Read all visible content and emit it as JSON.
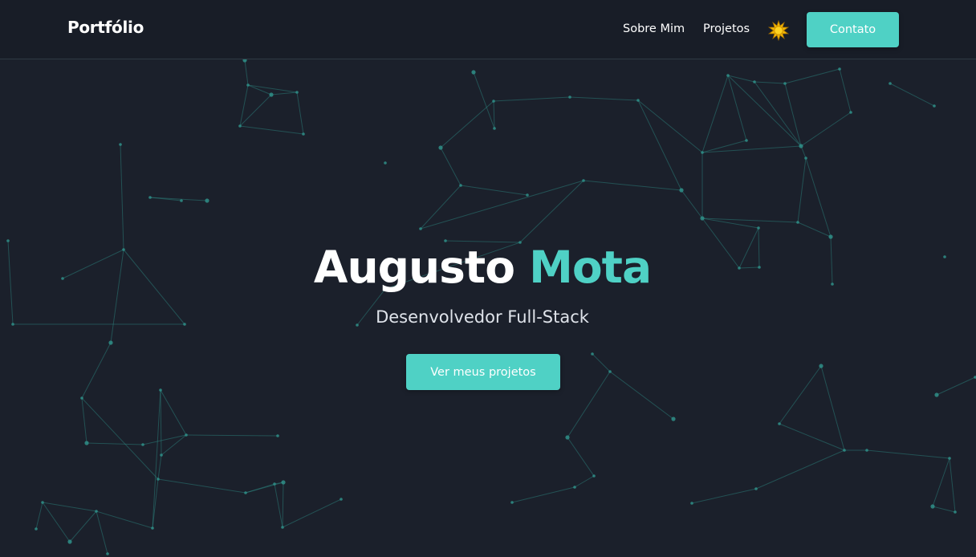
{
  "navbar": {
    "brand": "Portfólio",
    "links": [
      "Sobre Mim",
      "Projetos"
    ],
    "theme_icon": "sun-icon",
    "contact_label": "Contato"
  },
  "hero": {
    "name_first": "Augusto",
    "name_last": "Mota",
    "subtitle": "Desenvolvedor Full-Stack",
    "cta_label": "Ver meus projetos"
  },
  "colors": {
    "background": "#1b202b",
    "navbar": "#181d27",
    "accent": "#4fd1c5",
    "text": "#ffffff",
    "particle": "#2f8f88"
  }
}
